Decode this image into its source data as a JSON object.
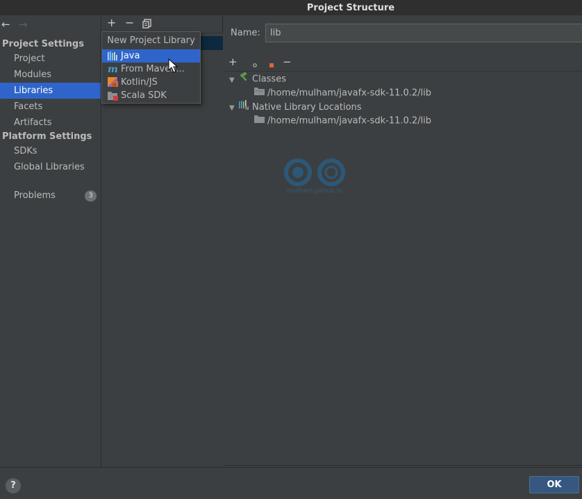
{
  "window": {
    "title": "Project Structure"
  },
  "nav": {
    "back_icon": "←",
    "forward_icon": "→",
    "project_settings_header": "Project Settings",
    "project_settings_items": [
      {
        "label": "Project"
      },
      {
        "label": "Modules"
      },
      {
        "label": "Libraries"
      },
      {
        "label": "Facets"
      },
      {
        "label": "Artifacts"
      }
    ],
    "platform_settings_header": "Platform Settings",
    "platform_settings_items": [
      {
        "label": "SDKs"
      },
      {
        "label": "Global Libraries"
      }
    ],
    "problems": {
      "label": "Problems",
      "count": "3"
    },
    "selected": "Libraries"
  },
  "libraries_toolbar": {
    "add": "+",
    "remove": "−",
    "copy": "copy-icon"
  },
  "popup": {
    "title": "New Project Library",
    "items": [
      {
        "label": "Java",
        "icon": "java-library-icon"
      },
      {
        "label": "From Maven...",
        "icon": "maven-icon"
      },
      {
        "label": "Kotlin/JS",
        "icon": "kotlin-js-icon"
      },
      {
        "label": "Scala SDK",
        "icon": "scala-sdk-icon"
      }
    ],
    "selected": "Java"
  },
  "details": {
    "name_label": "Name:",
    "name_value": "lib",
    "toolbar": {
      "add": "+",
      "add_with_options": "+",
      "add_jar": "+",
      "remove": "−"
    },
    "tree": [
      {
        "label": "Classes",
        "icon": "hammer-icon",
        "children": [
          {
            "label": "/home/mulham/javafx-sdk-11.0.2/lib",
            "icon": "jar-folder-icon"
          }
        ]
      },
      {
        "label": "Native Library Locations",
        "icon": "native-library-icon",
        "children": [
          {
            "label": "/home/mulham/javafx-sdk-11.0.2/lib",
            "icon": "folder-icon"
          }
        ]
      }
    ]
  },
  "watermark": {
    "text": "mulham.github.io"
  },
  "footer": {
    "help": "?",
    "ok": "OK"
  },
  "colors": {
    "background": "#3c3f41",
    "selection": "#2f65ca",
    "ok_button": "#365880",
    "title_bar": "#2f2f2f"
  }
}
